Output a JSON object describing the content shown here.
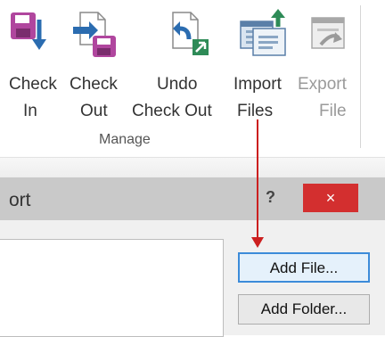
{
  "ribbon": {
    "buttons": [
      {
        "name": "check-in",
        "line1": "Check",
        "line2": "In",
        "icon": "check-in-icon",
        "disabled": false
      },
      {
        "name": "check-out",
        "line1": "Check",
        "line2": "Out",
        "icon": "check-out-icon",
        "disabled": false
      },
      {
        "name": "undo-check-out",
        "line1": "Undo",
        "line2": "Check Out",
        "icon": "undo-check-out-icon",
        "disabled": false
      },
      {
        "name": "import-files",
        "line1": "Import",
        "line2": "Files",
        "icon": "import-files-icon",
        "disabled": false
      },
      {
        "name": "export-file",
        "line1": "Export",
        "line2": "File",
        "icon": "export-file-icon",
        "disabled": true
      }
    ],
    "group_label": "Manage"
  },
  "dialog": {
    "title_partial": "ort",
    "help_label": "?",
    "close_label": "×",
    "add_file_label": "Add File...",
    "add_folder_label": "Add Folder..."
  },
  "colors": {
    "close_button": "#d32f2f",
    "arrow": "#cc1f1f",
    "disk_purple": "#b0469e",
    "arrow_blue": "#2b6cb0",
    "green": "#2e8b57"
  }
}
